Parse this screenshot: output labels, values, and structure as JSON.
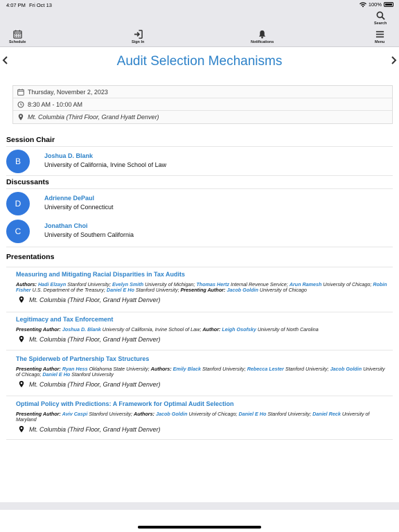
{
  "status": {
    "time": "4:07 PM",
    "date": "Fri Oct 13",
    "battery": "100%"
  },
  "toolbar": {
    "schedule": "Schedule",
    "sign_in": "Sign In",
    "notifications": "Notifications",
    "search": "Search",
    "menu": "Menu"
  },
  "page": {
    "title": "Audit Selection Mechanisms"
  },
  "info": {
    "date": "Thursday, November 2, 2023",
    "time": "8:30 AM - 10:00 AM",
    "location": "Mt. Columbia (Third Floor, Grand Hyatt Denver)"
  },
  "session_chair": {
    "heading": "Session Chair",
    "people": [
      {
        "initial": "B",
        "name": "Joshua D. Blank",
        "affiliation": "University of California, Irvine School of Law"
      }
    ]
  },
  "discussants": {
    "heading": "Discussants",
    "people": [
      {
        "initial": "D",
        "name": "Adrienne DePaul",
        "affiliation": "University of Connecticut"
      },
      {
        "initial": "C",
        "name": "Jonathan Choi",
        "affiliation": "University of Southern California"
      }
    ]
  },
  "presentations": {
    "heading": "Presentations",
    "items": [
      {
        "title": "Measuring and Mitigating Racial Disparities in Tax Audits",
        "segments": [
          {
            "t": "Authors: ",
            "k": "b"
          },
          {
            "t": "Hadi Elzayn",
            "k": "a"
          },
          {
            "t": " Stanford University; ",
            "k": "n"
          },
          {
            "t": "Evelyn Smith",
            "k": "a"
          },
          {
            "t": " University of Michigan; ",
            "k": "n"
          },
          {
            "t": "Thomas Hertz",
            "k": "a"
          },
          {
            "t": " Internal Revenue Service; ",
            "k": "n"
          },
          {
            "t": "Arun Ramesh",
            "k": "a"
          },
          {
            "t": " University of Chicago; ",
            "k": "n"
          },
          {
            "t": "Robin Fisher",
            "k": "a"
          },
          {
            "t": " U.S. Department of the Treasury; ",
            "k": "n"
          },
          {
            "t": "Daniel E Ho",
            "k": "a"
          },
          {
            "t": " Stanford University; ",
            "k": "n"
          },
          {
            "t": "Presenting Author: ",
            "k": "b"
          },
          {
            "t": "Jacob Goldin",
            "k": "a"
          },
          {
            "t": " University of Chicago",
            "k": "n"
          }
        ],
        "location": "Mt. Columbia (Third Floor, Grand Hyatt Denver)"
      },
      {
        "title": "Legitimacy and Tax Enforcement",
        "segments": [
          {
            "t": "Presenting Author: ",
            "k": "b"
          },
          {
            "t": "Joshua D. Blank",
            "k": "a"
          },
          {
            "t": " University of California, Irvine School of Law; ",
            "k": "n"
          },
          {
            "t": "Author: ",
            "k": "b"
          },
          {
            "t": "Leigh Osofsky",
            "k": "a"
          },
          {
            "t": " University of North Carolina",
            "k": "n"
          }
        ],
        "location": "Mt. Columbia (Third Floor, Grand Hyatt Denver)"
      },
      {
        "title": "The Spiderweb of Partnership Tax Structures",
        "segments": [
          {
            "t": "Presenting Author: ",
            "k": "b"
          },
          {
            "t": "Ryan Hess",
            "k": "a"
          },
          {
            "t": " Oklahoma State University; ",
            "k": "n"
          },
          {
            "t": "Authors: ",
            "k": "b"
          },
          {
            "t": "Emily Black",
            "k": "a"
          },
          {
            "t": " Stanford University; ",
            "k": "n"
          },
          {
            "t": "Rebecca Lester",
            "k": "a"
          },
          {
            "t": " Stanford University; ",
            "k": "n"
          },
          {
            "t": "Jacob Goldin",
            "k": "a"
          },
          {
            "t": " University of Chicago; ",
            "k": "n"
          },
          {
            "t": "Daniel E Ho",
            "k": "a"
          },
          {
            "t": " Stanford University",
            "k": "n"
          }
        ],
        "location": "Mt. Columbia (Third Floor, Grand Hyatt Denver)"
      },
      {
        "title": "Optimal Policy with Predictions: A Framework for Optimal Audit Selection",
        "segments": [
          {
            "t": "Presenting Author: ",
            "k": "b"
          },
          {
            "t": "Aviv Caspi",
            "k": "a"
          },
          {
            "t": " Stanford University; ",
            "k": "n"
          },
          {
            "t": "Authors: ",
            "k": "b"
          },
          {
            "t": "Jacob Goldin",
            "k": "a"
          },
          {
            "t": " University of Chicago; ",
            "k": "n"
          },
          {
            "t": "Daniel E Ho",
            "k": "a"
          },
          {
            "t": " Stanford University; ",
            "k": "n"
          },
          {
            "t": "Daniel Reck",
            "k": "a"
          },
          {
            "t": " University of Maryland",
            "k": "n"
          }
        ],
        "location": "Mt. Columbia (Third Floor, Grand Hyatt Denver)"
      }
    ]
  },
  "colors": {
    "accent": "#2d82c9",
    "avatar": "#3178dd",
    "toolbar_bg": "#e8e8ec"
  }
}
